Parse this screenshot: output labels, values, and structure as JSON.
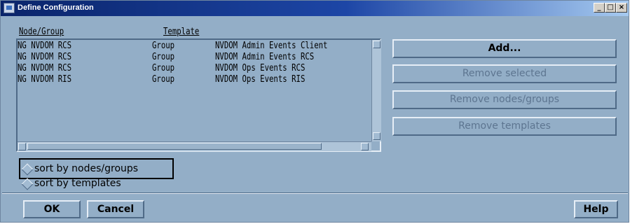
{
  "window": {
    "title": "Define Configuration",
    "icon": "app-window-icon",
    "controls": {
      "minimize": "_",
      "maximize": "□",
      "close": "×"
    }
  },
  "table": {
    "headers": [
      "Node/Group",
      "Template"
    ],
    "rows": [
      [
        "NG NVDOM RCS",
        "Group",
        "NVDOM Admin Events Client"
      ],
      [
        "NG NVDOM RCS",
        "Group",
        "NVDOM Admin Events RCS"
      ],
      [
        "NG NVDOM RCS",
        "Group",
        "NVDOM Ops Events RCS"
      ],
      [
        "NG NVDOM RIS",
        "Group",
        "NVDOM Ops Events RIS"
      ]
    ]
  },
  "actions": {
    "add": "Add...",
    "remove_selected": "Remove selected",
    "remove_nodes_groups": "Remove nodes/groups",
    "remove_templates": "Remove templates"
  },
  "sort": {
    "options": [
      "sort by nodes/groups",
      "sort by templates"
    ],
    "focused": "sort by nodes/groups"
  },
  "footer": {
    "ok": "OK",
    "cancel": "Cancel",
    "help": "Help"
  },
  "colors": {
    "dialog_bg": "#93aec7",
    "titlebar_start": "#0a246a",
    "titlebar_end": "#a6caf0",
    "disabled_text": "#5d7590"
  }
}
